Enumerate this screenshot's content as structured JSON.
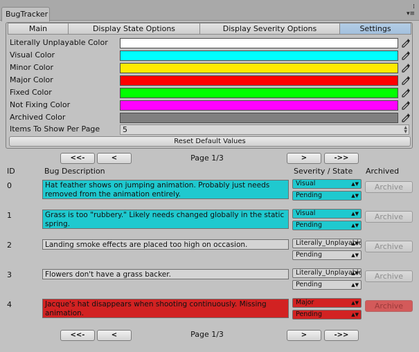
{
  "window": {
    "title": "BugTracker",
    "menu_glyph_top": "⁞",
    "menu_glyph_bottom": "▾≡"
  },
  "tabs": [
    {
      "label": "Main",
      "width": 88
    },
    {
      "label": "Display State Options",
      "width": 190
    },
    {
      "label": "Display Severity Options",
      "width": 202
    },
    {
      "label": "Settings",
      "width": 103
    }
  ],
  "settings": {
    "colors": [
      {
        "label": "Literally Unplayable Color",
        "hex": "#ffffff"
      },
      {
        "label": "Visual Color",
        "hex": "#00ffff"
      },
      {
        "label": "Minor Color",
        "hex": "#ffea00"
      },
      {
        "label": "Major Color",
        "hex": "#ff0000"
      },
      {
        "label": "Fixed Color",
        "hex": "#00ff00"
      },
      {
        "label": "Not Fixing Color",
        "hex": "#ff00ff"
      },
      {
        "label": "Archived Color",
        "hex": "#808080"
      }
    ],
    "items_label": "Items To Show Per Page",
    "items_value": "5",
    "reset_label": "Reset Default Values"
  },
  "nav": {
    "first": "<<-",
    "prev": "<",
    "next": ">",
    "last": "->>",
    "page": "Page 1/3"
  },
  "headers": {
    "id": "ID",
    "description": "Bug Description",
    "severity_state": "Severity / State",
    "archived": "Archived"
  },
  "archive_label": "Archive",
  "bugs": [
    {
      "id": "0",
      "description": "Hat feather shows on jumping animation. Probably just needs removed from the animation entirely.",
      "severity": "Visual",
      "state": "Pending",
      "color": "#1fc9cf"
    },
    {
      "id": "1",
      "description": "Grass is too \"rubbery.\" Likely needs changed globally in the static spring.",
      "severity": "Visual",
      "state": "Pending",
      "color": "#1fc9cf"
    },
    {
      "id": "2",
      "description": "Landing smoke effects are placed too high on occasion.",
      "severity": "Literally_Unplayable",
      "state": "Pending",
      "color": "#d4d4d4"
    },
    {
      "id": "3",
      "description": "Flowers don't have a grass backer.",
      "severity": "Literally_Unplayable",
      "state": "Pending",
      "color": "#d4d4d4"
    },
    {
      "id": "4",
      "description": "Jacque's hat disappears when shooting continuously. Missing animation.",
      "severity": "Major",
      "state": "Pending",
      "color": "#d22222",
      "archive_color": "#d35a5a"
    }
  ]
}
